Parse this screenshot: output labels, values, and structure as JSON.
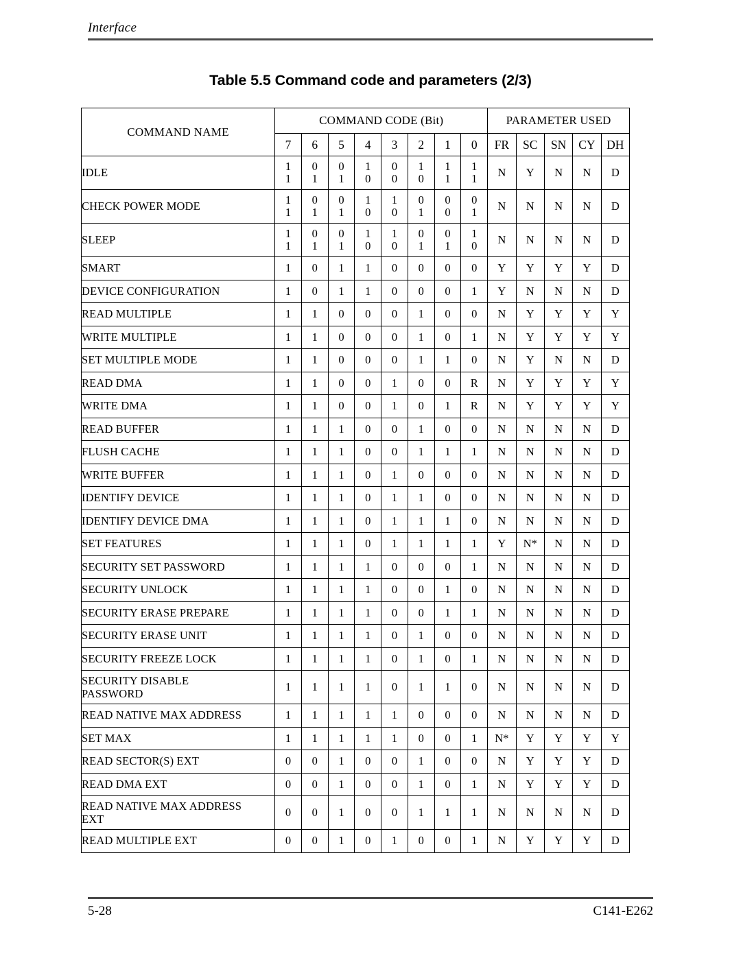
{
  "header": {
    "running_head": "Interface"
  },
  "title": "Table 5.5  Command code and parameters (2/3)",
  "table": {
    "col_name_header": "COMMAND NAME",
    "group_headers": {
      "command_code": "COMMAND CODE (Bit)",
      "parameter_used": "PARAMETER USED"
    },
    "bit_headers": [
      "7",
      "6",
      "5",
      "4",
      "3",
      "2",
      "1",
      "0"
    ],
    "param_headers": [
      "FR",
      "SC",
      "SN",
      "CY",
      "DH"
    ],
    "rows": [
      {
        "name": "IDLE",
        "lines": 2,
        "bits_line1": [
          "1",
          "0",
          "0",
          "1",
          "0",
          "1",
          "1",
          "1"
        ],
        "bits_line2": [
          "1",
          "1",
          "1",
          "0",
          "0",
          "0",
          "1",
          "1"
        ],
        "params": [
          "N",
          "Y",
          "N",
          "N",
          "D"
        ]
      },
      {
        "name": "CHECK POWER MODE",
        "lines": 2,
        "bits_line1": [
          "1",
          "0",
          "0",
          "1",
          "1",
          "0",
          "0",
          "0"
        ],
        "bits_line2": [
          "1",
          "1",
          "1",
          "0",
          "0",
          "1",
          "0",
          "1"
        ],
        "params": [
          "N",
          "N",
          "N",
          "N",
          "D"
        ]
      },
      {
        "name": "SLEEP",
        "lines": 2,
        "bits_line1": [
          "1",
          "0",
          "0",
          "1",
          "1",
          "0",
          "0",
          "1"
        ],
        "bits_line2": [
          "1",
          "1",
          "1",
          "0",
          "0",
          "1",
          "1",
          "0"
        ],
        "params": [
          "N",
          "N",
          "N",
          "N",
          "D"
        ]
      },
      {
        "name": "SMART",
        "lines": 1,
        "bits_line1": [
          "1",
          "0",
          "1",
          "1",
          "0",
          "0",
          "0",
          "0"
        ],
        "params": [
          "Y",
          "Y",
          "Y",
          "Y",
          "D"
        ]
      },
      {
        "name": "DEVICE CONFIGURATION",
        "lines": 1,
        "bits_line1": [
          "1",
          "0",
          "1",
          "1",
          "0",
          "0",
          "0",
          "1"
        ],
        "params": [
          "Y",
          "N",
          "N",
          "N",
          "D"
        ]
      },
      {
        "name": "READ MULTIPLE",
        "lines": 1,
        "bits_line1": [
          "1",
          "1",
          "0",
          "0",
          "0",
          "1",
          "0",
          "0"
        ],
        "params": [
          "N",
          "Y",
          "Y",
          "Y",
          "Y"
        ]
      },
      {
        "name": "WRITE MULTIPLE",
        "lines": 1,
        "bits_line1": [
          "1",
          "1",
          "0",
          "0",
          "0",
          "1",
          "0",
          "1"
        ],
        "params": [
          "N",
          "Y",
          "Y",
          "Y",
          "Y"
        ]
      },
      {
        "name": "SET MULTIPLE MODE",
        "lines": 1,
        "bits_line1": [
          "1",
          "1",
          "0",
          "0",
          "0",
          "1",
          "1",
          "0"
        ],
        "params": [
          "N",
          "Y",
          "N",
          "N",
          "D"
        ]
      },
      {
        "name": "READ DMA",
        "lines": 1,
        "bits_line1": [
          "1",
          "1",
          "0",
          "0",
          "1",
          "0",
          "0",
          "R"
        ],
        "params": [
          "N",
          "Y",
          "Y",
          "Y",
          "Y"
        ]
      },
      {
        "name": "WRITE DMA",
        "lines": 1,
        "bits_line1": [
          "1",
          "1",
          "0",
          "0",
          "1",
          "0",
          "1",
          "R"
        ],
        "params": [
          "N",
          "Y",
          "Y",
          "Y",
          "Y"
        ]
      },
      {
        "name": "READ BUFFER",
        "lines": 1,
        "bits_line1": [
          "1",
          "1",
          "1",
          "0",
          "0",
          "1",
          "0",
          "0"
        ],
        "params": [
          "N",
          "N",
          "N",
          "N",
          "D"
        ]
      },
      {
        "name": "FLUSH CACHE",
        "lines": 1,
        "bits_line1": [
          "1",
          "1",
          "1",
          "0",
          "0",
          "1",
          "1",
          "1"
        ],
        "params": [
          "N",
          "N",
          "N",
          "N",
          "D"
        ]
      },
      {
        "name": "WRITE BUFFER",
        "lines": 1,
        "bits_line1": [
          "1",
          "1",
          "1",
          "0",
          "1",
          "0",
          "0",
          "0"
        ],
        "params": [
          "N",
          "N",
          "N",
          "N",
          "D"
        ]
      },
      {
        "name": "IDENTIFY DEVICE",
        "lines": 1,
        "bits_line1": [
          "1",
          "1",
          "1",
          "0",
          "1",
          "1",
          "0",
          "0"
        ],
        "params": [
          "N",
          "N",
          "N",
          "N",
          "D"
        ]
      },
      {
        "name": "IDENTIFY DEVICE DMA",
        "lines": 1,
        "bits_line1": [
          "1",
          "1",
          "1",
          "0",
          "1",
          "1",
          "1",
          "0"
        ],
        "params": [
          "N",
          "N",
          "N",
          "N",
          "D"
        ]
      },
      {
        "name": "SET FEATURES",
        "lines": 1,
        "bits_line1": [
          "1",
          "1",
          "1",
          "0",
          "1",
          "1",
          "1",
          "1"
        ],
        "params": [
          "Y",
          "N*",
          "N",
          "N",
          "D"
        ]
      },
      {
        "name": "SECURITY SET PASSWORD",
        "lines": 1,
        "bits_line1": [
          "1",
          "1",
          "1",
          "1",
          "0",
          "0",
          "0",
          "1"
        ],
        "params": [
          "N",
          "N",
          "N",
          "N",
          "D"
        ]
      },
      {
        "name": "SECURITY UNLOCK",
        "lines": 1,
        "bits_line1": [
          "1",
          "1",
          "1",
          "1",
          "0",
          "0",
          "1",
          "0"
        ],
        "params": [
          "N",
          "N",
          "N",
          "N",
          "D"
        ]
      },
      {
        "name": "SECURITY ERASE PREPARE",
        "lines": 1,
        "bits_line1": [
          "1",
          "1",
          "1",
          "1",
          "0",
          "0",
          "1",
          "1"
        ],
        "params": [
          "N",
          "N",
          "N",
          "N",
          "D"
        ]
      },
      {
        "name": "SECURITY ERASE UNIT",
        "lines": 1,
        "bits_line1": [
          "1",
          "1",
          "1",
          "1",
          "0",
          "1",
          "0",
          "0"
        ],
        "params": [
          "N",
          "N",
          "N",
          "N",
          "D"
        ]
      },
      {
        "name": "SECURITY FREEZE LOCK",
        "lines": 1,
        "bits_line1": [
          "1",
          "1",
          "1",
          "1",
          "0",
          "1",
          "0",
          "1"
        ],
        "params": [
          "N",
          "N",
          "N",
          "N",
          "D"
        ]
      },
      {
        "name": "SECURITY DISABLE PASSWORD",
        "name_line1": "SECURITY DISABLE",
        "name_line2": "PASSWORD",
        "lines": 2,
        "name_wrapped": true,
        "bits_line1": [
          "1",
          "1",
          "1",
          "1",
          "0",
          "1",
          "1",
          "0"
        ],
        "params": [
          "N",
          "N",
          "N",
          "N",
          "D"
        ]
      },
      {
        "name": "READ NATIVE MAX ADDRESS",
        "lines": 1,
        "bits_line1": [
          "1",
          "1",
          "1",
          "1",
          "1",
          "0",
          "0",
          "0"
        ],
        "params": [
          "N",
          "N",
          "N",
          "N",
          "D"
        ]
      },
      {
        "name": "SET MAX",
        "lines": 1,
        "bits_line1": [
          "1",
          "1",
          "1",
          "1",
          "1",
          "0",
          "0",
          "1"
        ],
        "params": [
          "N*",
          "Y",
          "Y",
          "Y",
          "Y"
        ]
      },
      {
        "name": "READ SECTOR(S) EXT",
        "lines": 1,
        "bits_line1": [
          "0",
          "0",
          "1",
          "0",
          "0",
          "1",
          "0",
          "0"
        ],
        "params": [
          "N",
          "Y",
          "Y",
          "Y",
          "D"
        ]
      },
      {
        "name": "READ DMA EXT",
        "lines": 1,
        "bits_line1": [
          "0",
          "0",
          "1",
          "0",
          "0",
          "1",
          "0",
          "1"
        ],
        "params": [
          "N",
          "Y",
          "Y",
          "Y",
          "D"
        ]
      },
      {
        "name": "READ NATIVE MAX ADDRESS EXT",
        "name_line1": "READ NATIVE MAX ADDRESS",
        "name_line2": "EXT",
        "lines": 2,
        "name_wrapped": true,
        "bits_line1": [
          "0",
          "0",
          "1",
          "0",
          "0",
          "1",
          "1",
          "1"
        ],
        "params": [
          "N",
          "N",
          "N",
          "N",
          "D"
        ]
      },
      {
        "name": "READ MULTIPLE EXT",
        "lines": 1,
        "bits_line1": [
          "0",
          "0",
          "1",
          "0",
          "1",
          "0",
          "0",
          "1"
        ],
        "params": [
          "N",
          "Y",
          "Y",
          "Y",
          "D"
        ]
      }
    ]
  },
  "footer": {
    "page_number": "5-28",
    "document_id": "C141-E262"
  }
}
